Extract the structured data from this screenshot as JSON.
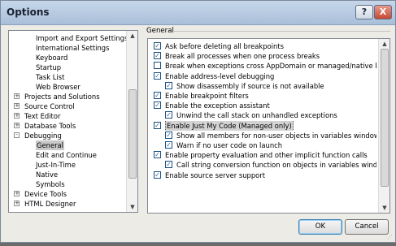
{
  "window": {
    "title": "Options",
    "help_button": "?",
    "close_button": "X"
  },
  "tree": {
    "items": [
      {
        "label": "Import and Export Settings",
        "indent": 2,
        "expander": ""
      },
      {
        "label": "International Settings",
        "indent": 2,
        "expander": ""
      },
      {
        "label": "Keyboard",
        "indent": 2,
        "expander": ""
      },
      {
        "label": "Startup",
        "indent": 2,
        "expander": ""
      },
      {
        "label": "Task List",
        "indent": 2,
        "expander": ""
      },
      {
        "label": "Web Browser",
        "indent": 2,
        "expander": ""
      },
      {
        "label": "Projects and Solutions",
        "indent": 1,
        "expander": "+"
      },
      {
        "label": "Source Control",
        "indent": 1,
        "expander": "+"
      },
      {
        "label": "Text Editor",
        "indent": 1,
        "expander": "+"
      },
      {
        "label": "Database Tools",
        "indent": 1,
        "expander": "+"
      },
      {
        "label": "Debugging",
        "indent": 1,
        "expander": "-"
      },
      {
        "label": "General",
        "indent": 2,
        "expander": "",
        "selected": true
      },
      {
        "label": "Edit and Continue",
        "indent": 2,
        "expander": ""
      },
      {
        "label": "Just-In-Time",
        "indent": 2,
        "expander": ""
      },
      {
        "label": "Native",
        "indent": 2,
        "expander": ""
      },
      {
        "label": "Symbols",
        "indent": 2,
        "expander": ""
      },
      {
        "label": "Device Tools",
        "indent": 1,
        "expander": "+"
      },
      {
        "label": "HTML Designer",
        "indent": 1,
        "expander": "+"
      }
    ]
  },
  "panel": {
    "group_label": "General",
    "options": [
      {
        "label": "Ask before deleting all breakpoints",
        "checked": true,
        "indent": 0
      },
      {
        "label": "Break all processes when one process breaks",
        "checked": true,
        "indent": 0
      },
      {
        "label": "Break when exceptions cross AppDomain or managed/native boundar",
        "checked": false,
        "indent": 0
      },
      {
        "label": "Enable address-level debugging",
        "checked": true,
        "indent": 0
      },
      {
        "label": "Show disassembly if source is not available",
        "checked": true,
        "indent": 1
      },
      {
        "label": "Enable breakpoint filters",
        "checked": true,
        "indent": 0
      },
      {
        "label": "Enable the exception assistant",
        "checked": true,
        "indent": 0
      },
      {
        "label": "Unwind the call stack on unhandled exceptions",
        "checked": true,
        "indent": 1
      },
      {
        "label": "Enable Just My Code (Managed only)",
        "checked": true,
        "indent": 0,
        "selected": true
      },
      {
        "label": "Show all members for non-user objects in variables windows (Visu",
        "checked": true,
        "indent": 1
      },
      {
        "label": "Warn if no user code on launch",
        "checked": true,
        "indent": 1
      },
      {
        "label": "Enable property evaluation and other implicit function calls",
        "checked": true,
        "indent": 0
      },
      {
        "label": "Call string conversion function on objects in variables windows (C",
        "checked": true,
        "indent": 1
      },
      {
        "label": "Enable source server support",
        "checked": true,
        "indent": 0
      }
    ]
  },
  "buttons": {
    "ok": "OK",
    "cancel": "Cancel"
  }
}
